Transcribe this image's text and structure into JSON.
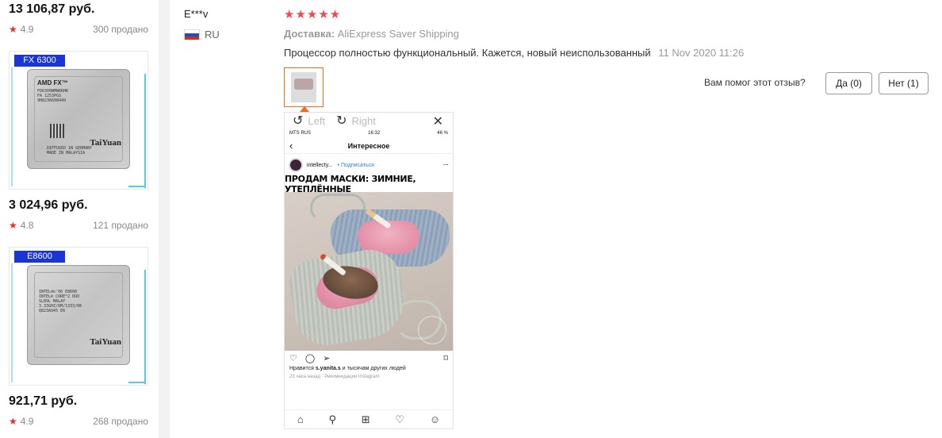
{
  "products": [
    {
      "price": "13 106,87 руб.",
      "rating": "4.9",
      "sold": "300 продано"
    },
    {
      "tag": "FX 6300",
      "chip_brand": "TaiYuan",
      "chip_logo": "AMD FX™",
      "chip_text": [
        "FD6300WMW6KHK",
        "FA 1253PGS",
        "9H8236608449",
        "",
        "",
        "DIFFUSED IN GERMANY",
        "MADE IN MALAYSIA"
      ],
      "price": "3 024,96 руб.",
      "rating": "4.8",
      "sold": "121 продано"
    },
    {
      "tag": "E8600",
      "chip_brand": "TaiYuan",
      "chip_text": [
        "INTEL®©'06 E8600",
        "INTEL® CORE™2 DUO",
        "SLB9L MALAY",
        "3.33GHZ/6M/1333/06",
        "Q823A945 E6"
      ],
      "price": "921,71 руб.",
      "rating": "4.9",
      "sold": "268 продано"
    }
  ],
  "review": {
    "reviewer": "E***v",
    "country": "RU",
    "stars": "★★★★★",
    "delivery_label": "Доставка:",
    "delivery_value": "AliExpress Saver Shipping",
    "text": "Процессор полностью функциональный. Кажется, новый неиспользованный",
    "date": "11 Nov 2020 11:26",
    "helpful_question": "Вам помог этот отзыв?",
    "yes_label": "Да (0)",
    "no_label": "Нет (1)"
  },
  "viewer": {
    "rotate_left": "Left",
    "rotate_right": "Right",
    "close": "✕"
  },
  "instagram": {
    "carrier": "MTS RUS",
    "time": "16:32",
    "battery": "46 %",
    "screen_title": "Интересное",
    "username": "intellecty...",
    "follow": "• Подписаться",
    "headline": "ПРОДАМ МАСКИ: ЗИМНИЕ, УТЕПЛЁННЫЕ",
    "likes_prefix": "Нравится ",
    "likes_user": "s.yanita.s",
    "likes_suffix": " и тысячам других людей",
    "meta": "23 часа назад · Рекомендации Instagram"
  },
  "colors": {
    "accent_red": "#e62e2e",
    "tag_blue": "#1a34d6",
    "thumb_orange": "#f26a1b"
  }
}
